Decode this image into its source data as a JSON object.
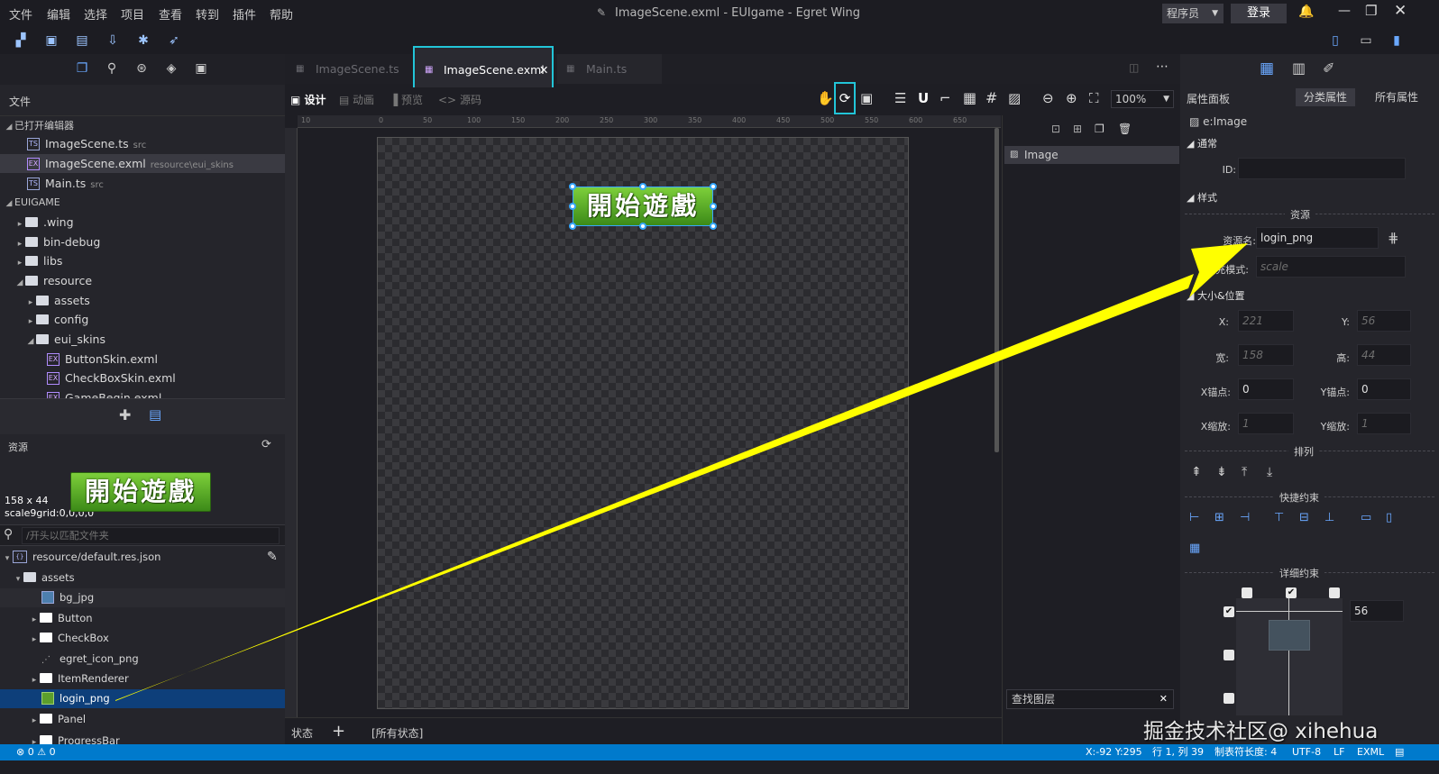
{
  "window": {
    "title": "ImageScene.exml - EUIgame - Egret Wing",
    "user_role": "程序员",
    "login_label": "登录"
  },
  "menu": [
    "文件",
    "编辑",
    "选择",
    "项目",
    "查看",
    "转到",
    "插件",
    "帮助"
  ],
  "left": {
    "files_title": "文件",
    "open_editors_title": "已打开编辑器",
    "open_editors": [
      {
        "name": "ImageScene.ts",
        "path": "src"
      },
      {
        "name": "ImageScene.exml",
        "path": "resource\\eui_skins"
      },
      {
        "name": "Main.ts",
        "path": "src"
      }
    ],
    "project_title": "EUIGAME",
    "tree": [
      ".wing",
      "bin-debug",
      "libs",
      "resource",
      "assets",
      "config",
      "eui_skins",
      "ButtonSkin.exml",
      "CheckBoxSkin.exml",
      "GameBegin.exml"
    ],
    "resources_title": "资源",
    "preview_size": "158 x 44",
    "preview_grid": "scale9grid:0,0,0,0",
    "preview_text": "開始遊戲",
    "search_placeholder": "/开头以匹配文件夹",
    "res_tree": [
      "resource/default.res.json",
      "assets",
      "bg_jpg",
      "Button",
      "CheckBox",
      "egret_icon_png",
      "ItemRenderer",
      "login_png",
      "Panel",
      "ProgressBar"
    ]
  },
  "editor": {
    "tabs": [
      "ImageScene.ts",
      "ImageScene.exml",
      "Main.ts"
    ],
    "modes": [
      "设计",
      "动画",
      "预览",
      "源码"
    ],
    "zoom": "100%",
    "ruler": [
      "0",
      "50",
      "100",
      "150",
      "200",
      "250",
      "300",
      "350",
      "400",
      "450",
      "500",
      "550",
      "600",
      "650"
    ],
    "ruler_neg": [
      "10"
    ],
    "image_text": "開始遊戲",
    "layers": [
      "Image"
    ],
    "layer_search": "查找图层",
    "state_label": "状态",
    "all_states": "[所有状态]"
  },
  "props": {
    "title": "属性面板",
    "tab_category": "分类属性",
    "tab_all": "所有属性",
    "element": "e:Image",
    "sec_common": "通常",
    "id_label": "ID:",
    "sec_style": "样式",
    "res_group": "资源",
    "res_name_label": "资源名:",
    "res_name": "login_png",
    "fill_label": "填充模式:",
    "fill_value": "scale",
    "sec_size": "大小&位置",
    "x_label": "X:",
    "x": "221",
    "y_label": "Y:",
    "y": "56",
    "w_label": "宽:",
    "w": "158",
    "h_label": "高:",
    "h": "44",
    "ax_label": "X锚点:",
    "ax": "0",
    "ay_label": "Y锚点:",
    "ay": "0",
    "sx_label": "X缩放:",
    "sx": "1",
    "sy_label": "Y缩放:",
    "sy": "1",
    "arrange": "排列",
    "quick": "快捷约束",
    "detail": "详细约束",
    "constraint_top": "56"
  },
  "status": {
    "errors": "0",
    "warnings": "0",
    "coords": "X:-92 Y:295",
    "line": "行 1, 列 39",
    "tab": "制表符长度: 4",
    "enc": "UTF-8",
    "eol": "LF",
    "lang": "EXML"
  },
  "watermark": "掘金技术社区@ xihehua",
  "colors": {
    "accent": "#007acc",
    "highlight_box": "#22c5d8",
    "arrow": "#ffff00",
    "selection": "#0e3f7a"
  }
}
